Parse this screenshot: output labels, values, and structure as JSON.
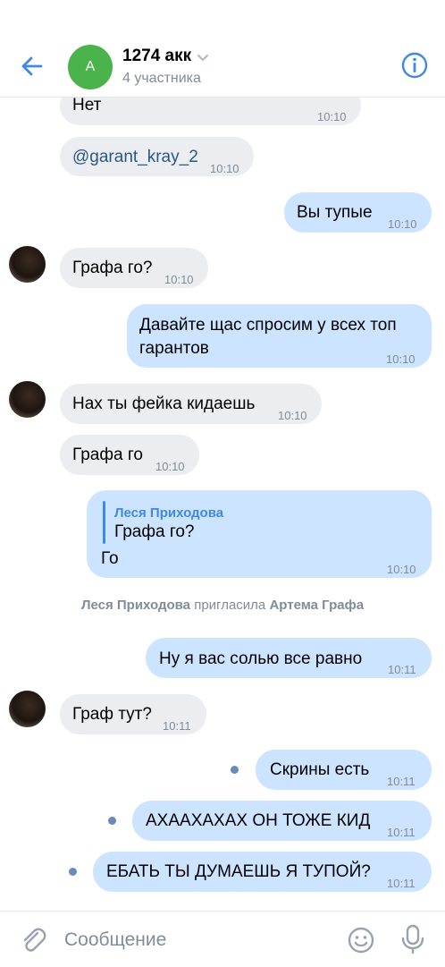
{
  "header": {
    "avatar_letter": "A",
    "title": "1274 акк",
    "subtitle": "4 участника"
  },
  "messages": {
    "m1": {
      "text": "Нет",
      "time": "10:10"
    },
    "m2": {
      "text": "@garant_kray_2",
      "time": "10:10"
    },
    "m3": {
      "text": "Вы тупые",
      "time": "10:10"
    },
    "m4": {
      "text": "Графа го?",
      "time": "10:10"
    },
    "m5": {
      "line1": "Давайте щас спросим у всех топ",
      "line2": "гарантов",
      "time": "10:10"
    },
    "m6": {
      "text": "Нах ты фейка кидаешь",
      "time": "10:10"
    },
    "m7": {
      "text": "Графа го",
      "time": "10:10"
    },
    "m8": {
      "reply_name": "Леся Приходова",
      "reply_text": "Графа го?",
      "text": "Го",
      "time": "10:10"
    },
    "m9": {
      "text": "Ну я вас солью все равно",
      "time": "10:11"
    },
    "m10": {
      "text": "Граф тут?",
      "time": "10:11"
    },
    "m11": {
      "text": "Скрины есть",
      "time": "10:11"
    },
    "m12": {
      "text": "АХААХАХАХ ОН ТОЖЕ КИД",
      "time": "10:11"
    },
    "m13": {
      "text": "ЕБАТЬ ТЫ ДУМАЕШЬ Я ТУПОЙ?",
      "time": "10:11"
    }
  },
  "system": {
    "actor": "Леся Приходова",
    "action": "пригласила",
    "target": "Артема Графа"
  },
  "composer": {
    "placeholder": "Сообщение"
  },
  "colors": {
    "accent": "#3f8ae0",
    "incoming_bubble": "#ebedf0",
    "outgoing_bubble": "#cce4ff",
    "avatar_green": "#4bb34b"
  },
  "icons": [
    "back-arrow-icon",
    "chevron-down-icon",
    "info-icon",
    "paperclip-icon",
    "smile-icon",
    "microphone-icon"
  ]
}
